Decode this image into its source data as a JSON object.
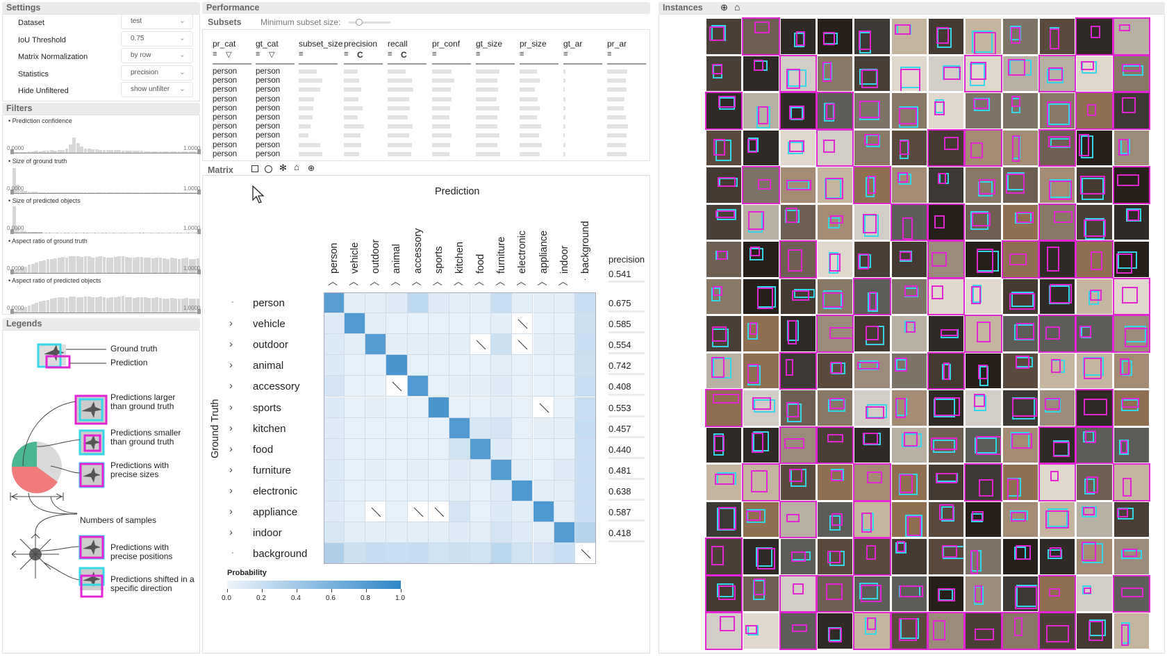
{
  "headers": {
    "settings": "Settings",
    "performance": "Performance",
    "instances": "Instances",
    "filters": "Filters",
    "legends": "Legends",
    "subsets": "Subsets",
    "matrix": "Matrix"
  },
  "settings": [
    {
      "label": "Dataset",
      "value": "test"
    },
    {
      "label": "IoU Threshold",
      "value": "0.75"
    },
    {
      "label": "Matrix Normalization",
      "value": "by row"
    },
    {
      "label": "Statistics",
      "value": "precision"
    },
    {
      "label": "Hide Unfiltered",
      "value": "show unfilter"
    }
  ],
  "filters": [
    {
      "label": "Prediction confidence",
      "min": "0.0000",
      "max": "1.0000",
      "bars": [
        2,
        2,
        3,
        3,
        4,
        5,
        7,
        6,
        7,
        8,
        9,
        8,
        9,
        10,
        16,
        30,
        55,
        36,
        22,
        16,
        14,
        13,
        12,
        11,
        11,
        10,
        10,
        9,
        9,
        8,
        8,
        8,
        7,
        7,
        7,
        6,
        6,
        6,
        5,
        5,
        5,
        5,
        5,
        5,
        4,
        4,
        4,
        4,
        4,
        3
      ]
    },
    {
      "label": "Size of ground truth",
      "min": "0.0000",
      "max": "1.0000",
      "bars": [
        90,
        30,
        10,
        6,
        4,
        3,
        3,
        2,
        2,
        2,
        2,
        1,
        1,
        1,
        1,
        1,
        1,
        1,
        1,
        1,
        1,
        1,
        1,
        1,
        1,
        1,
        1,
        1,
        1,
        1,
        1,
        1,
        1,
        1,
        1,
        1,
        1,
        1,
        1,
        1,
        1,
        1,
        1,
        1,
        1,
        1,
        1,
        1,
        1,
        1
      ]
    },
    {
      "label": "Size of predicted objects",
      "min": "0.0000",
      "max": "1.0000",
      "bars": [
        95,
        20,
        7,
        4,
        3,
        2,
        2,
        2,
        1,
        1,
        1,
        1,
        1,
        1,
        1,
        1,
        1,
        1,
        1,
        1,
        1,
        1,
        1,
        1,
        1,
        1,
        1,
        1,
        1,
        1,
        1,
        1,
        1,
        1,
        1,
        1,
        1,
        1,
        1,
        1,
        1,
        1,
        1,
        1,
        1,
        1,
        1,
        1,
        1,
        1
      ]
    },
    {
      "label": "Aspect ratio of ground truth",
      "min": "0.0000",
      "max": "1.0000",
      "bars": [
        8,
        12,
        18,
        22,
        28,
        32,
        36,
        42,
        45,
        48,
        50,
        52,
        55,
        56,
        54,
        58,
        60,
        58,
        56,
        60,
        58,
        55,
        57,
        59,
        56,
        54,
        55,
        57,
        58,
        60,
        56,
        55,
        53,
        56,
        57,
        55,
        54,
        52,
        55,
        53,
        52,
        50,
        54,
        52,
        50,
        51,
        53,
        50,
        49,
        52
      ]
    },
    {
      "label": "Aspect ratio of predicted objects",
      "min": "0.0000",
      "max": "1.0000",
      "bars": [
        6,
        10,
        15,
        20,
        26,
        30,
        35,
        40,
        43,
        46,
        50,
        52,
        54,
        55,
        53,
        57,
        58,
        56,
        55,
        58,
        57,
        54,
        56,
        58,
        55,
        53,
        55,
        56,
        57,
        59,
        55,
        54,
        52,
        55,
        56,
        54,
        53,
        52,
        54,
        52,
        51,
        50,
        53,
        51,
        50,
        50,
        52,
        50,
        49,
        51
      ]
    }
  ],
  "legends": {
    "ground_truth": "Ground truth",
    "prediction": "Prediction",
    "larger": "Predictions larger than ground truth",
    "smaller": "Predictions smaller than ground truth",
    "precise_sizes": "Predictions with precise sizes",
    "num_samples": "Numbers of samples",
    "precise_positions": "Predictions with precise positions",
    "shifted": "Predictions shifted in a specific direction"
  },
  "subsets": {
    "min_size_label": "Minimum subset size:",
    "columns": [
      "pr_cat",
      "gt_cat",
      "subset_size",
      "precision",
      "recall",
      "pr_conf",
      "gt_size",
      "pr_size",
      "gt_ar",
      "pr_ar"
    ],
    "sort_c": "C",
    "rows": [
      {
        "pr_cat": "person",
        "gt_cat": "person",
        "b": [
          0.46,
          0.35,
          0.46,
          0.5,
          0.6,
          0.44,
          0.05,
          0.52
        ]
      },
      {
        "pr_cat": "person",
        "gt_cat": "person",
        "b": [
          0.6,
          0.4,
          0.62,
          0.58,
          0.55,
          0.52,
          0.06,
          0.48
        ]
      },
      {
        "pr_cat": "person",
        "gt_cat": "person",
        "b": [
          0.55,
          0.45,
          0.66,
          0.48,
          0.58,
          0.4,
          0.04,
          0.5
        ]
      },
      {
        "pr_cat": "person",
        "gt_cat": "person",
        "b": [
          0.4,
          0.38,
          0.56,
          0.5,
          0.53,
          0.46,
          0.05,
          0.45
        ]
      },
      {
        "pr_cat": "person",
        "gt_cat": "person",
        "b": [
          0.38,
          0.48,
          0.58,
          0.46,
          0.6,
          0.52,
          0.06,
          0.42
        ]
      },
      {
        "pr_cat": "person",
        "gt_cat": "person",
        "b": [
          0.35,
          0.36,
          0.52,
          0.44,
          0.56,
          0.44,
          0.05,
          0.48
        ]
      },
      {
        "pr_cat": "person",
        "gt_cat": "person",
        "b": [
          0.3,
          0.52,
          0.64,
          0.47,
          0.55,
          0.55,
          0.05,
          0.53
        ]
      },
      {
        "pr_cat": "person",
        "gt_cat": "person",
        "b": [
          0.25,
          0.42,
          0.55,
          0.5,
          0.6,
          0.5,
          0.04,
          0.5
        ]
      },
      {
        "pr_cat": "person",
        "gt_cat": "person",
        "b": [
          0.55,
          0.45,
          0.62,
          0.47,
          0.56,
          0.58,
          0.06,
          0.48
        ]
      },
      {
        "pr_cat": "person",
        "gt_cat": "person",
        "b": [
          0.6,
          0.4,
          0.6,
          0.44,
          0.62,
          0.52,
          0.05,
          0.5
        ]
      }
    ]
  },
  "matrix": {
    "prediction_title": "Prediction",
    "gt_title": "Ground Truth",
    "precision_label": "precision",
    "precision_top": "0.541",
    "categories": [
      "person",
      "vehicle",
      "outdoor",
      "animal",
      "accessory",
      "sports",
      "kitchen",
      "food",
      "furniture",
      "electronic",
      "appliance",
      "indoor",
      "background"
    ],
    "precision": [
      "0.675",
      "0.585",
      "0.554",
      "0.742",
      "0.408",
      "0.553",
      "0.457",
      "0.440",
      "0.481",
      "0.638",
      "0.587",
      "0.418"
    ],
    "colorbar": {
      "title": "Probability",
      "ticks": [
        "0.0",
        "0.2",
        "0.4",
        "0.6",
        "0.8",
        "1.0"
      ]
    },
    "values": [
      [
        0.78,
        0.06,
        0.06,
        0.08,
        0.25,
        0.08,
        0.06,
        0.06,
        0.2,
        0.06,
        0.06,
        0.06,
        0.2
      ],
      [
        0.08,
        0.82,
        0.06,
        0.04,
        0.04,
        0.04,
        0.04,
        0.04,
        0.06,
        0.0,
        0.04,
        0.04,
        0.18
      ],
      [
        0.1,
        0.06,
        0.8,
        0.05,
        0.05,
        0.05,
        0.05,
        0.0,
        0.18,
        0.0,
        0.05,
        0.05,
        0.2
      ],
      [
        0.1,
        0.04,
        0.04,
        0.86,
        0.04,
        0.04,
        0.04,
        0.04,
        0.06,
        0.04,
        0.04,
        0.04,
        0.18
      ],
      [
        0.14,
        0.04,
        0.04,
        0.0,
        0.82,
        0.04,
        0.05,
        0.05,
        0.08,
        0.04,
        0.04,
        0.04,
        0.2
      ],
      [
        0.1,
        0.04,
        0.05,
        0.04,
        0.04,
        0.86,
        0.04,
        0.04,
        0.06,
        0.04,
        0.0,
        0.04,
        0.2
      ],
      [
        0.08,
        0.04,
        0.04,
        0.04,
        0.04,
        0.04,
        0.82,
        0.12,
        0.14,
        0.04,
        0.05,
        0.05,
        0.22
      ],
      [
        0.08,
        0.04,
        0.04,
        0.04,
        0.04,
        0.04,
        0.16,
        0.8,
        0.08,
        0.04,
        0.04,
        0.04,
        0.2
      ],
      [
        0.1,
        0.04,
        0.05,
        0.04,
        0.05,
        0.04,
        0.08,
        0.06,
        0.8,
        0.06,
        0.04,
        0.08,
        0.2
      ],
      [
        0.1,
        0.04,
        0.04,
        0.04,
        0.04,
        0.04,
        0.05,
        0.04,
        0.08,
        0.84,
        0.06,
        0.06,
        0.2
      ],
      [
        0.08,
        0.04,
        0.0,
        0.04,
        0.0,
        0.0,
        0.14,
        0.04,
        0.1,
        0.06,
        0.84,
        0.06,
        0.2
      ],
      [
        0.12,
        0.06,
        0.06,
        0.06,
        0.06,
        0.06,
        0.08,
        0.06,
        0.14,
        0.08,
        0.06,
        0.8,
        0.3
      ],
      [
        0.34,
        0.18,
        0.22,
        0.2,
        0.22,
        0.16,
        0.18,
        0.16,
        0.28,
        0.16,
        0.14,
        0.2,
        0.0
      ]
    ]
  }
}
